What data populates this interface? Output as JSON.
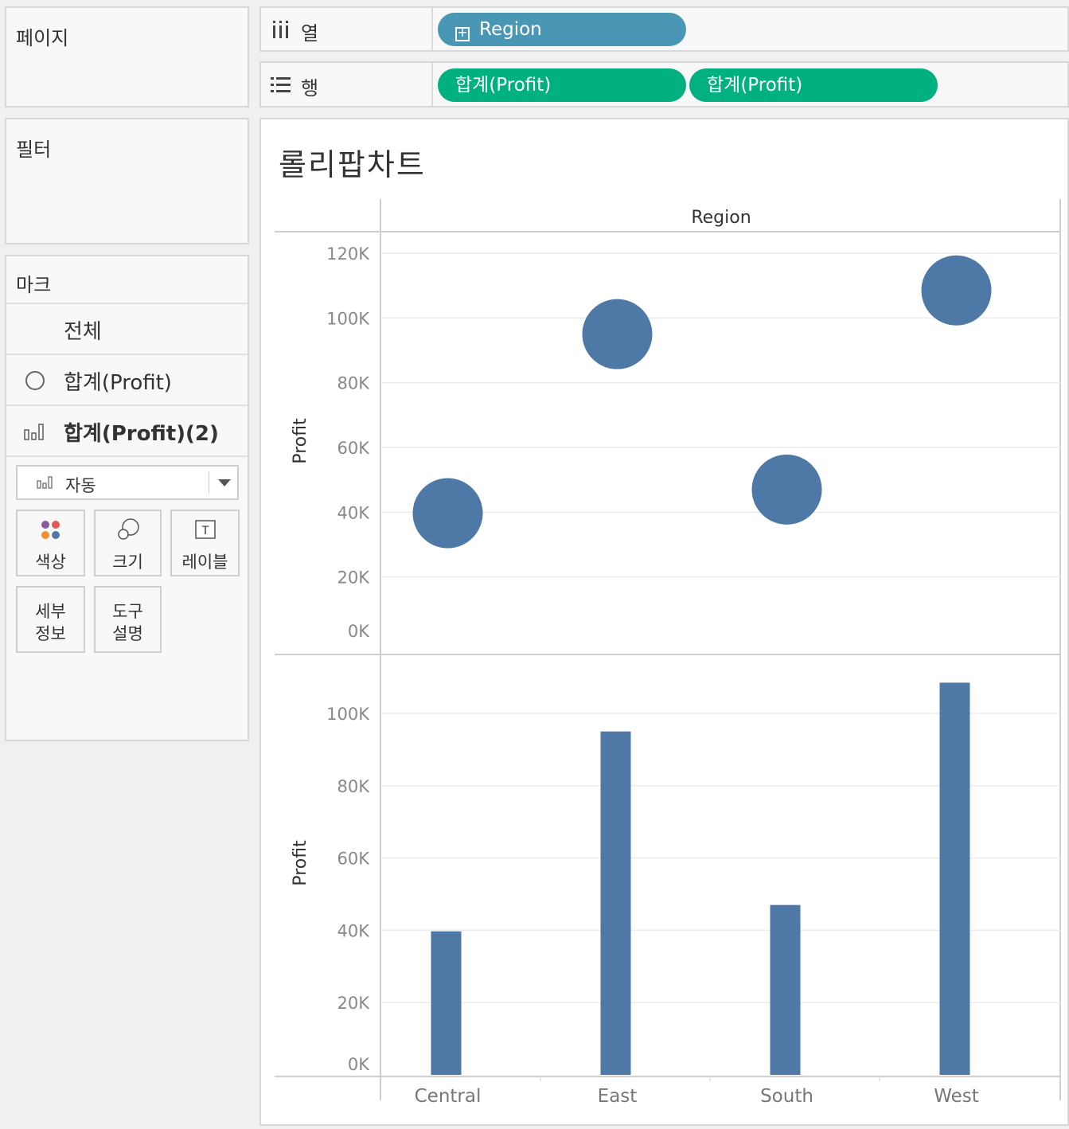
{
  "pages_card": {
    "title": "페이지"
  },
  "filters_card": {
    "title": "필터"
  },
  "columns_shelf": {
    "label": "열",
    "pills": [
      "Region"
    ]
  },
  "rows_shelf": {
    "label": "행",
    "pills": [
      "합계(Profit)",
      "합계(Profit)"
    ]
  },
  "marks_card": {
    "title": "마크",
    "items": [
      {
        "label": "전체",
        "icon": "none",
        "bold": false
      },
      {
        "label": "합계(Profit)",
        "icon": "circle-icon",
        "bold": false
      },
      {
        "label": "합계(Profit)(2)",
        "icon": "bar-chart-icon",
        "bold": true
      }
    ],
    "mark_type": "자동",
    "buttons": {
      "color": "색상",
      "size": "크기",
      "label": "레이블",
      "detail_1": "세부",
      "detail_2": "정보",
      "tooltip_1": "도구",
      "tooltip_2": "설명"
    }
  },
  "view": {
    "title": "롤리팝차트",
    "column_header": "Region"
  },
  "colors": {
    "mark": "#4e79a7",
    "dimension_pill": "#4a96b5",
    "measure_pill": "#00b07e"
  },
  "chart_data": [
    {
      "type": "scatter",
      "categories": [
        "Central",
        "East",
        "South",
        "West"
      ],
      "values": [
        39700,
        95000,
        47000,
        108500
      ],
      "ylabel": "Profit",
      "ylim": [
        0,
        120000
      ],
      "yticks": [
        "0K",
        "20K",
        "40K",
        "60K",
        "80K",
        "100K",
        "120K"
      ],
      "grid": true
    },
    {
      "type": "bar",
      "categories": [
        "Central",
        "East",
        "South",
        "West"
      ],
      "values": [
        39700,
        95000,
        47000,
        108500
      ],
      "ylabel": "Profit",
      "ylim": [
        0,
        110000
      ],
      "yticks": [
        "0K",
        "20K",
        "40K",
        "60K",
        "80K",
        "100K"
      ],
      "xlabel": "",
      "grid": true
    }
  ]
}
